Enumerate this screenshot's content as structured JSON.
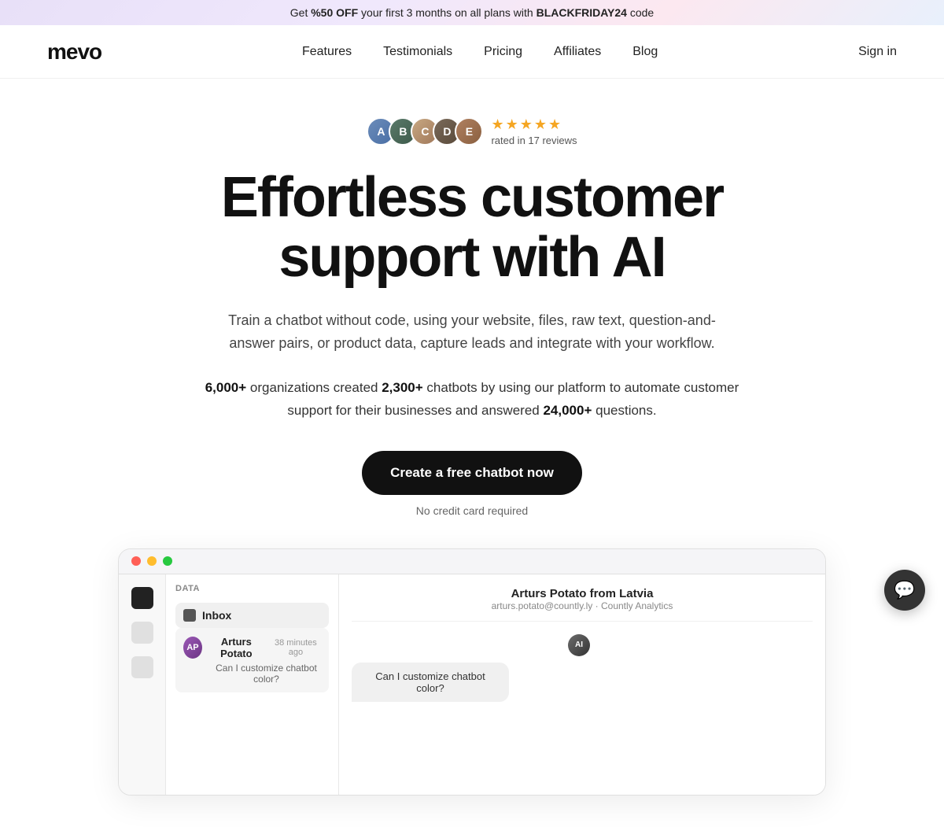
{
  "banner": {
    "prefix": "Get ",
    "highlight1": "%50 OFF",
    "middle": " your first 3 months on all plans with ",
    "highlight2": "BLACKFRIDAY24",
    "suffix": " code"
  },
  "nav": {
    "logo": "mevo",
    "links": [
      {
        "label": "Features",
        "href": "#"
      },
      {
        "label": "Testimonials",
        "href": "#"
      },
      {
        "label": "Pricing",
        "href": "#"
      },
      {
        "label": "Affiliates",
        "href": "#"
      },
      {
        "label": "Blog",
        "href": "#"
      }
    ],
    "signin_label": "Sign in"
  },
  "hero": {
    "stars": "★★★★★",
    "review_text": "rated in 17 reviews",
    "headline_line1": "Effortless customer",
    "headline_line2": "support with AI",
    "subheadline": "Train a chatbot without code, using your website, files, raw text, question-and-answer pairs, or product data, capture leads and integrate with your workflow.",
    "stats": {
      "num1": "6,000+",
      "text1": " organizations created ",
      "num2": "2,300+",
      "text2": " chatbots by using our platform to automate customer support for their businesses and answered ",
      "num3": "24,000+",
      "text3": " questions."
    },
    "cta_label": "Create a free chatbot now",
    "no_card_text": "No credit card required"
  },
  "dashboard": {
    "data_label": "DATA",
    "inbox_label": "Inbox",
    "message": {
      "name": "Arturs Potato",
      "time": "38 minutes ago",
      "preview": "Can I customize chatbot color?",
      "location": "Arturs Potato from Latvia",
      "email": "arturs.potato@countly.ly · Countly Analytics"
    }
  },
  "chat_widget": {
    "icon": "💬"
  }
}
